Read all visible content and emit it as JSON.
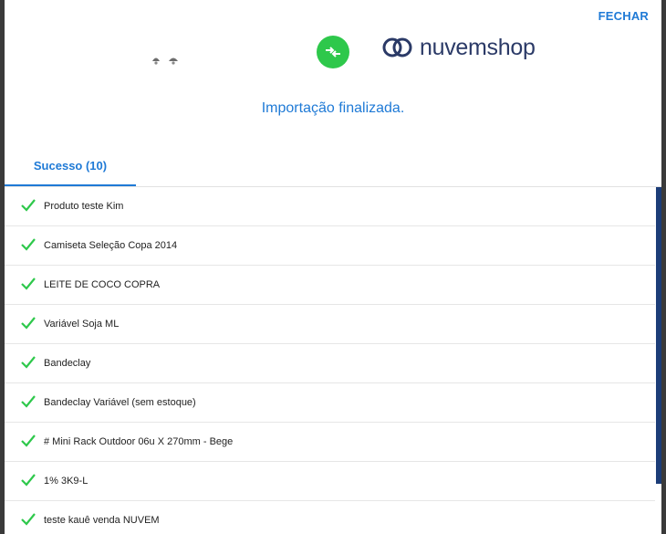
{
  "modal": {
    "close_label": "FECHAR",
    "brand_name": "nuvemshop",
    "status_message": "Importação finalizada.",
    "colors": {
      "accent": "#1f7ad6",
      "success": "#2ec84b",
      "brand": "#2b3a67"
    },
    "icons": {
      "transfer": "arrows-swap-icon",
      "row": "check-icon"
    }
  },
  "tabs": [
    {
      "label": "Sucesso (10)",
      "active": true
    }
  ],
  "items": [
    {
      "label": "Produto teste Kim"
    },
    {
      "label": "Camiseta Seleção Copa 2014"
    },
    {
      "label": "LEITE DE COCO COPRA"
    },
    {
      "label": "Variável Soja ML"
    },
    {
      "label": "Bandeclay"
    },
    {
      "label": "Bandeclay Variável (sem estoque)"
    },
    {
      "label": "# Mini Rack Outdoor 06u X 270mm - Bege"
    },
    {
      "label": "1% 3K9-L"
    },
    {
      "label": "teste kauê venda NUVEM"
    }
  ]
}
